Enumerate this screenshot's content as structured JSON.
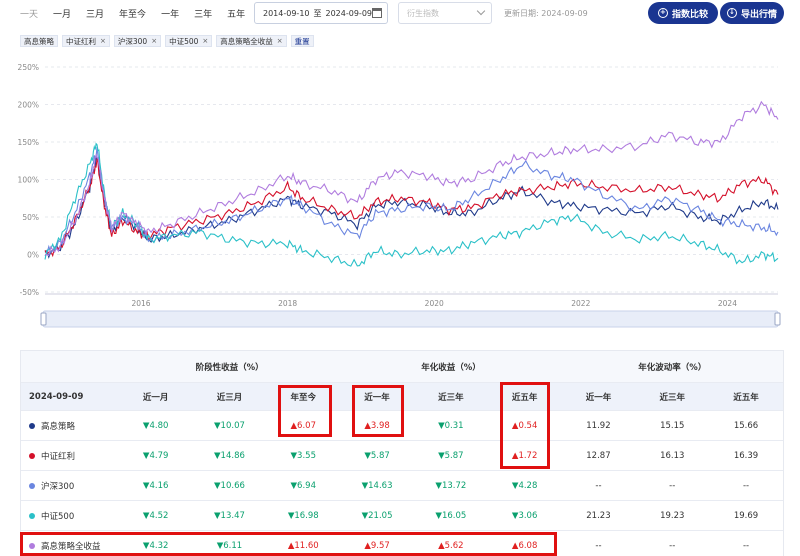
{
  "toolbar": {
    "ranges": [
      "一天",
      "一月",
      "三月",
      "年至今",
      "一年",
      "三年",
      "五年"
    ],
    "date_start": "2014-09-10",
    "date_sep": "至",
    "date_end": "2024-09-09",
    "derive_placeholder": "衍生指数",
    "updated": "更新日期: 2024-09-09",
    "compare_btn": "指数比较",
    "export_btn": "导出行情"
  },
  "chips": [
    {
      "label": "高息策略",
      "removable": false
    },
    {
      "label": "中证红利",
      "removable": true
    },
    {
      "label": "沪深300",
      "removable": true
    },
    {
      "label": "中证500",
      "removable": true
    },
    {
      "label": "高息策略全收益",
      "removable": true
    }
  ],
  "reset_label": "重置",
  "chart_data": {
    "type": "line",
    "y_ticks": [
      "250%",
      "200%",
      "150%",
      "100%",
      "50%",
      "0%",
      "-50%"
    ],
    "ylim": [
      -50,
      250
    ],
    "x_ticks": [
      "2016",
      "2018",
      "2020",
      "2022",
      "2024"
    ],
    "x_tick_years": [
      2016,
      2018,
      2020,
      2022,
      2024
    ],
    "xlim": [
      2014.69,
      2024.69
    ],
    "series": [
      {
        "name": "高息策略",
        "color": "#1f3a8a",
        "points": [
          [
            2014.69,
            0
          ],
          [
            2014.9,
            10
          ],
          [
            2015.1,
            40
          ],
          [
            2015.3,
            90
          ],
          [
            2015.4,
            130
          ],
          [
            2015.5,
            70
          ],
          [
            2015.6,
            30
          ],
          [
            2015.75,
            50
          ],
          [
            2015.95,
            35
          ],
          [
            2016.1,
            20
          ],
          [
            2016.4,
            25
          ],
          [
            2016.8,
            35
          ],
          [
            2017.2,
            45
          ],
          [
            2017.6,
            60
          ],
          [
            2018.0,
            75
          ],
          [
            2018.2,
            65
          ],
          [
            2018.6,
            55
          ],
          [
            2018.95,
            40
          ],
          [
            2019.2,
            65
          ],
          [
            2019.5,
            70
          ],
          [
            2019.9,
            65
          ],
          [
            2020.2,
            55
          ],
          [
            2020.5,
            55
          ],
          [
            2020.9,
            75
          ],
          [
            2021.2,
            85
          ],
          [
            2021.6,
            70
          ],
          [
            2021.9,
            65
          ],
          [
            2022.3,
            60
          ],
          [
            2022.8,
            55
          ],
          [
            2023.2,
            65
          ],
          [
            2023.6,
            50
          ],
          [
            2023.9,
            45
          ],
          [
            2024.2,
            60
          ],
          [
            2024.5,
            70
          ],
          [
            2024.69,
            60
          ]
        ]
      },
      {
        "name": "中证红利",
        "color": "#d4102a",
        "points": [
          [
            2014.69,
            0
          ],
          [
            2014.9,
            10
          ],
          [
            2015.1,
            45
          ],
          [
            2015.3,
            90
          ],
          [
            2015.4,
            125
          ],
          [
            2015.5,
            65
          ],
          [
            2015.6,
            25
          ],
          [
            2015.75,
            45
          ],
          [
            2015.95,
            30
          ],
          [
            2016.1,
            25
          ],
          [
            2016.4,
            35
          ],
          [
            2016.8,
            45
          ],
          [
            2017.2,
            55
          ],
          [
            2017.6,
            70
          ],
          [
            2018.0,
            90
          ],
          [
            2018.2,
            75
          ],
          [
            2018.6,
            60
          ],
          [
            2018.95,
            50
          ],
          [
            2019.2,
            70
          ],
          [
            2019.5,
            75
          ],
          [
            2019.9,
            70
          ],
          [
            2020.2,
            60
          ],
          [
            2020.5,
            62
          ],
          [
            2020.9,
            80
          ],
          [
            2021.2,
            85
          ],
          [
            2021.6,
            90
          ],
          [
            2021.9,
            95
          ],
          [
            2022.3,
            90
          ],
          [
            2022.8,
            85
          ],
          [
            2023.2,
            90
          ],
          [
            2023.6,
            80
          ],
          [
            2023.9,
            75
          ],
          [
            2024.2,
            95
          ],
          [
            2024.5,
            100
          ],
          [
            2024.69,
            80
          ]
        ]
      },
      {
        "name": "沪深300",
        "color": "#6b86e0",
        "points": [
          [
            2014.69,
            0
          ],
          [
            2014.9,
            15
          ],
          [
            2015.1,
            55
          ],
          [
            2015.3,
            105
          ],
          [
            2015.4,
            140
          ],
          [
            2015.5,
            75
          ],
          [
            2015.6,
            35
          ],
          [
            2015.75,
            50
          ],
          [
            2015.95,
            40
          ],
          [
            2016.1,
            20
          ],
          [
            2016.4,
            25
          ],
          [
            2016.8,
            35
          ],
          [
            2017.2,
            45
          ],
          [
            2017.6,
            60
          ],
          [
            2018.0,
            75
          ],
          [
            2018.2,
            65
          ],
          [
            2018.6,
            40
          ],
          [
            2018.95,
            25
          ],
          [
            2019.2,
            55
          ],
          [
            2019.5,
            60
          ],
          [
            2019.9,
            65
          ],
          [
            2020.2,
            60
          ],
          [
            2020.5,
            75
          ],
          [
            2020.9,
            100
          ],
          [
            2021.2,
            120
          ],
          [
            2021.6,
            105
          ],
          [
            2021.9,
            100
          ],
          [
            2022.3,
            80
          ],
          [
            2022.8,
            60
          ],
          [
            2023.2,
            75
          ],
          [
            2023.6,
            60
          ],
          [
            2023.9,
            45
          ],
          [
            2024.2,
            40
          ],
          [
            2024.5,
            35
          ],
          [
            2024.69,
            30
          ]
        ]
      },
      {
        "name": "中证500",
        "color": "#2bc0c8",
        "points": [
          [
            2014.69,
            0
          ],
          [
            2014.9,
            20
          ],
          [
            2015.1,
            75
          ],
          [
            2015.3,
            120
          ],
          [
            2015.4,
            150
          ],
          [
            2015.5,
            80
          ],
          [
            2015.6,
            35
          ],
          [
            2015.75,
            55
          ],
          [
            2015.95,
            40
          ],
          [
            2016.1,
            20
          ],
          [
            2016.4,
            25
          ],
          [
            2016.8,
            30
          ],
          [
            2017.2,
            20
          ],
          [
            2017.6,
            15
          ],
          [
            2018.0,
            15
          ],
          [
            2018.2,
            5
          ],
          [
            2018.6,
            -5
          ],
          [
            2018.95,
            -15
          ],
          [
            2019.2,
            5
          ],
          [
            2019.5,
            0
          ],
          [
            2019.9,
            5
          ],
          [
            2020.2,
            5
          ],
          [
            2020.5,
            15
          ],
          [
            2020.9,
            25
          ],
          [
            2021.2,
            30
          ],
          [
            2021.6,
            45
          ],
          [
            2021.9,
            50
          ],
          [
            2022.3,
            30
          ],
          [
            2022.8,
            20
          ],
          [
            2023.2,
            25
          ],
          [
            2023.6,
            15
          ],
          [
            2023.9,
            5
          ],
          [
            2024.2,
            -10
          ],
          [
            2024.5,
            0
          ],
          [
            2024.69,
            -5
          ]
        ]
      },
      {
        "name": "高息策略全收益",
        "color": "#b07cde",
        "points": [
          [
            2014.69,
            0
          ],
          [
            2014.9,
            10
          ],
          [
            2015.1,
            45
          ],
          [
            2015.3,
            95
          ],
          [
            2015.4,
            135
          ],
          [
            2015.5,
            75
          ],
          [
            2015.6,
            35
          ],
          [
            2015.75,
            55
          ],
          [
            2015.95,
            40
          ],
          [
            2016.1,
            30
          ],
          [
            2016.4,
            40
          ],
          [
            2016.8,
            55
          ],
          [
            2017.2,
            70
          ],
          [
            2017.6,
            85
          ],
          [
            2018.0,
            105
          ],
          [
            2018.2,
            95
          ],
          [
            2018.6,
            85
          ],
          [
            2018.95,
            70
          ],
          [
            2019.2,
            100
          ],
          [
            2019.5,
            110
          ],
          [
            2019.9,
            105
          ],
          [
            2020.2,
            95
          ],
          [
            2020.5,
            100
          ],
          [
            2020.9,
            120
          ],
          [
            2021.2,
            130
          ],
          [
            2021.6,
            135
          ],
          [
            2021.9,
            140
          ],
          [
            2022.3,
            140
          ],
          [
            2022.8,
            145
          ],
          [
            2023.2,
            160
          ],
          [
            2023.6,
            150
          ],
          [
            2023.9,
            150
          ],
          [
            2024.2,
            185
          ],
          [
            2024.5,
            200
          ],
          [
            2024.69,
            180
          ]
        ]
      }
    ],
    "grid": true
  },
  "table": {
    "groups": [
      "阶段性收益（%）",
      "年化收益（%）",
      "年化波动率（%）"
    ],
    "header": [
      "2024-09-09",
      "近一月",
      "近三月",
      "年至今",
      "近一年",
      "近三年",
      "近五年",
      "近一年",
      "近三年",
      "近五年"
    ],
    "rows": [
      {
        "name": "高息策略",
        "color": "#1f3a8a",
        "cells": [
          [
            "▼4.80",
            "down"
          ],
          [
            "▼10.07",
            "down"
          ],
          [
            "▲6.07",
            "up"
          ],
          [
            "▲3.98",
            "up"
          ],
          [
            "▼0.31",
            "down"
          ],
          [
            "▲0.54",
            "up"
          ],
          [
            "11.92",
            "neutral"
          ],
          [
            "15.15",
            "neutral"
          ],
          [
            "15.66",
            "neutral"
          ]
        ]
      },
      {
        "name": "中证红利",
        "color": "#d4102a",
        "cells": [
          [
            "▼4.79",
            "down"
          ],
          [
            "▼14.86",
            "down"
          ],
          [
            "▼3.55",
            "down"
          ],
          [
            "▼5.87",
            "down"
          ],
          [
            "▼5.87",
            "down"
          ],
          [
            "▲1.72",
            "up"
          ],
          [
            "12.87",
            "neutral"
          ],
          [
            "16.13",
            "neutral"
          ],
          [
            "16.39",
            "neutral"
          ]
        ]
      },
      {
        "name": "沪深300",
        "color": "#6b86e0",
        "cells": [
          [
            "▼4.16",
            "down"
          ],
          [
            "▼10.66",
            "down"
          ],
          [
            "▼6.94",
            "down"
          ],
          [
            "▼14.63",
            "down"
          ],
          [
            "▼13.72",
            "down"
          ],
          [
            "▼4.28",
            "down"
          ],
          [
            "--",
            "neutral"
          ],
          [
            "--",
            "neutral"
          ],
          [
            "--",
            "neutral"
          ]
        ]
      },
      {
        "name": "中证500",
        "color": "#2bc0c8",
        "cells": [
          [
            "▼4.52",
            "down"
          ],
          [
            "▼13.47",
            "down"
          ],
          [
            "▼16.98",
            "down"
          ],
          [
            "▼21.05",
            "down"
          ],
          [
            "▼16.05",
            "down"
          ],
          [
            "▼3.06",
            "down"
          ],
          [
            "21.23",
            "neutral"
          ],
          [
            "19.23",
            "neutral"
          ],
          [
            "19.69",
            "neutral"
          ]
        ]
      },
      {
        "name": "高息策略全收益",
        "color": "#b07cde",
        "cells": [
          [
            "▼4.32",
            "down"
          ],
          [
            "▼6.11",
            "down"
          ],
          [
            "▲11.60",
            "up"
          ],
          [
            "▲9.57",
            "up"
          ],
          [
            "▲5.62",
            "up"
          ],
          [
            "▲6.08",
            "up"
          ],
          [
            "--",
            "neutral"
          ],
          [
            "--",
            "neutral"
          ],
          [
            "--",
            "neutral"
          ]
        ]
      }
    ]
  }
}
